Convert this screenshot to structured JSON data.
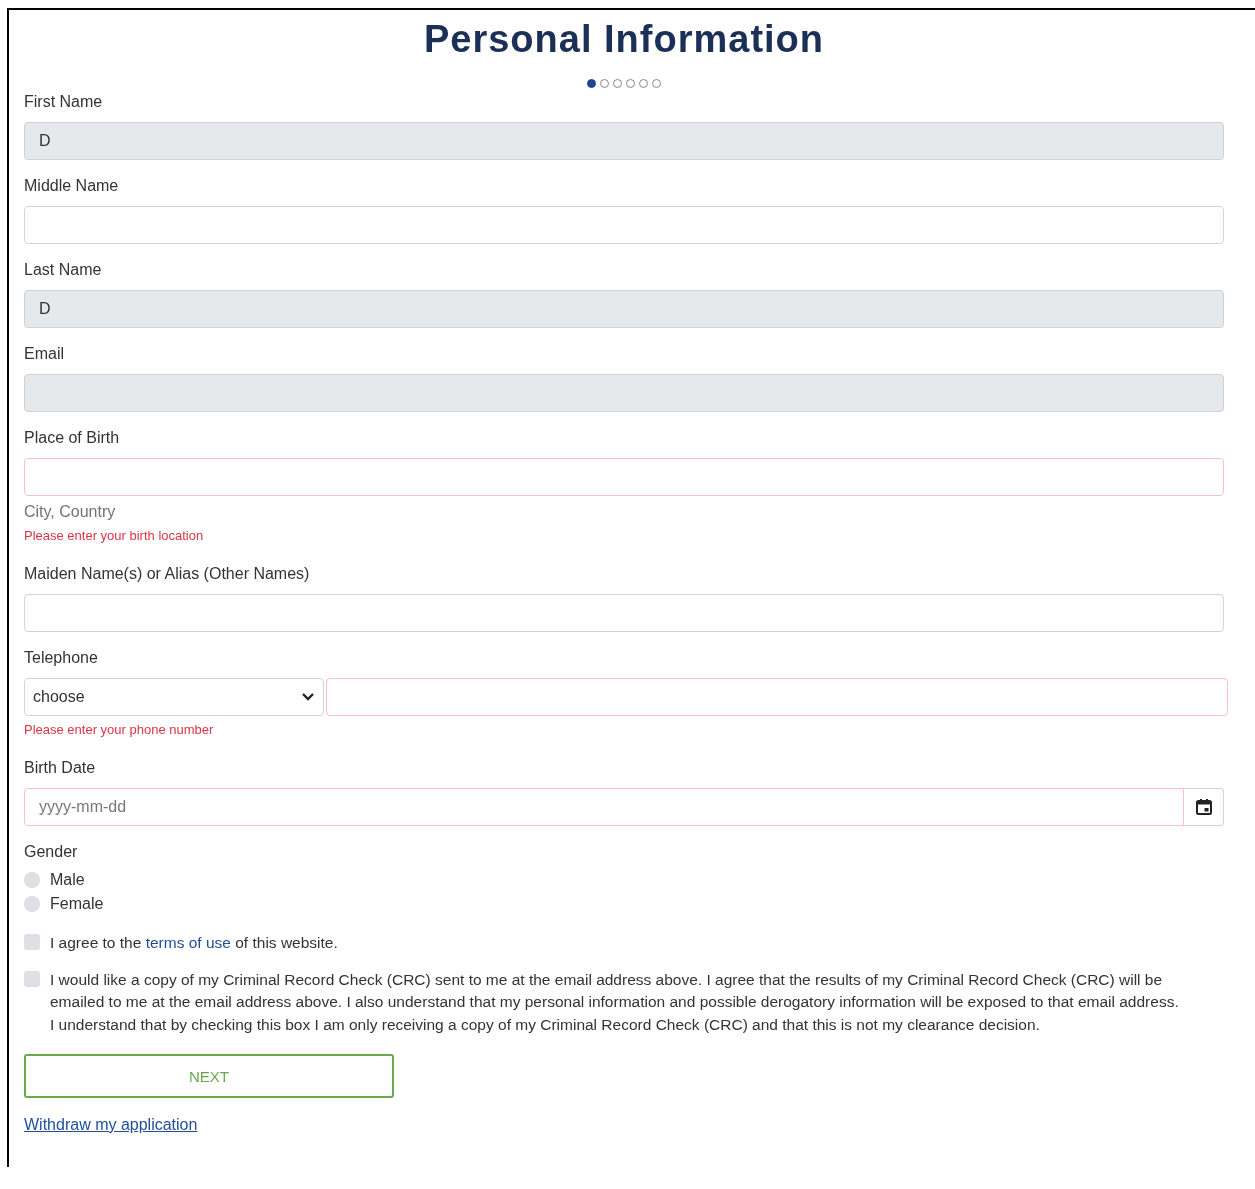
{
  "title": "Personal Information",
  "steps": [
    {
      "selected": true
    },
    {
      "selected": false
    },
    {
      "selected": false
    },
    {
      "selected": false
    },
    {
      "selected": false
    },
    {
      "selected": false
    }
  ],
  "fields": [
    {
      "kind": "text",
      "label": "First Name",
      "value": "D",
      "disabled": true,
      "invalid": false
    },
    {
      "kind": "text",
      "label": "Middle Name",
      "disabled": false,
      "invalid": false
    },
    {
      "kind": "text",
      "label": "Last Name",
      "value": "D",
      "disabled": true,
      "invalid": false
    },
    {
      "kind": "text",
      "label": "Email",
      "disabled": true,
      "invalid": false
    },
    {
      "kind": "text",
      "label": "Place of Birth",
      "disabled": false,
      "invalid": true,
      "hint": "City, Country",
      "error": "Please enter your birth location"
    },
    {
      "kind": "text",
      "label": "Maiden Name(s) or Alias (Other Names)",
      "disabled": false,
      "invalid": false
    },
    {
      "kind": "phone",
      "label": "Telephone",
      "select_value": "choose",
      "disabled": false,
      "invalid": true,
      "error": "Please enter your phone number"
    },
    {
      "kind": "date",
      "label": "Birth Date",
      "placeholder": "yyyy-mm-dd",
      "disabled": false,
      "invalid": true
    },
    {
      "kind": "radio",
      "label": "Gender",
      "options": [
        {
          "label": "Male",
          "selected": false
        },
        {
          "label": "Female",
          "selected": false
        }
      ]
    }
  ],
  "agreements": [
    {
      "checked": false,
      "paragraphs": [
        [
          {
            "kind": "text",
            "text": "I agree to the "
          },
          {
            "kind": "link",
            "text": "terms of use"
          },
          {
            "kind": "text",
            "text": " of this website."
          }
        ]
      ]
    },
    {
      "checked": false,
      "paragraphs": [
        [
          {
            "kind": "text",
            "text": "I would like a copy of my Criminal Record Check (CRC) sent to me at the email address above. I agree that the results of my Criminal Record Check (CRC) will be emailed to me at the email address above. I also understand that my personal information and possible derogatory information will be exposed to that email address."
          }
        ],
        [
          {
            "kind": "text",
            "text": "I understand that by checking this box I am only receiving a copy of my Criminal Record Check (CRC) and that this is not my clearance decision."
          }
        ]
      ]
    }
  ],
  "next_button": "NEXT",
  "withdraw_link": "Withdraw my application"
}
